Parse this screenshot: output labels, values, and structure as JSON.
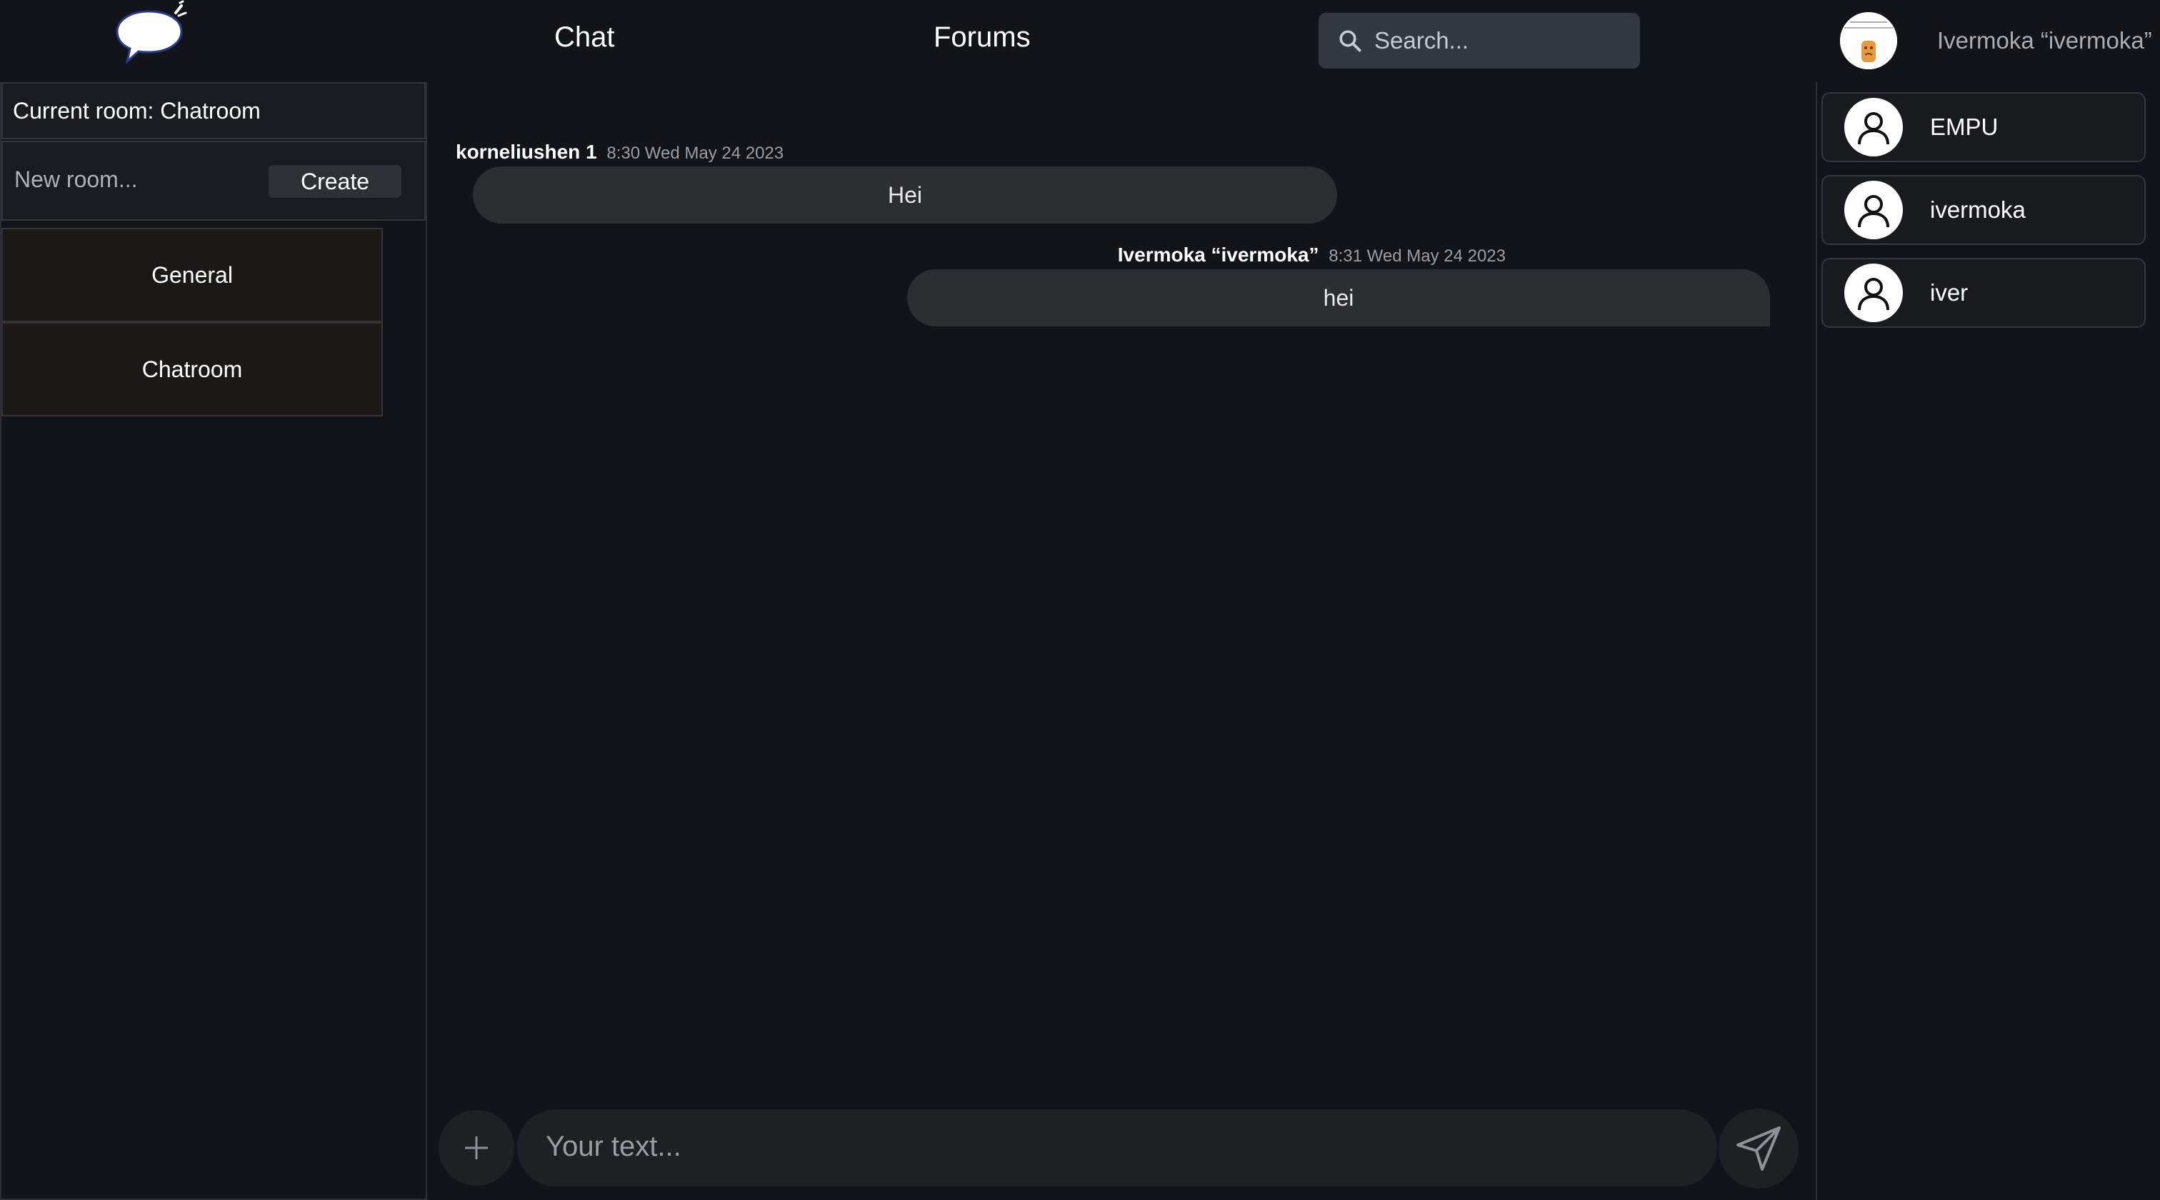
{
  "header": {
    "nav": {
      "chat": "Chat",
      "forums": "Forums"
    },
    "search": {
      "placeholder": "Search...",
      "value": ""
    },
    "profile": {
      "name": "Ivermoka “ivermoka”"
    }
  },
  "left_sidebar": {
    "current_room": "Current room: Chatroom",
    "new_room": {
      "placeholder": "New room...",
      "value": "",
      "create_label": "Create"
    },
    "rooms": [
      {
        "label": "General"
      },
      {
        "label": "Chatroom"
      }
    ]
  },
  "messages": [
    {
      "author": "korneliushen 1",
      "time": "8:30 Wed May 24 2023",
      "text": "Hei",
      "own": false
    },
    {
      "author": "Ivermoka “ivermoka”",
      "time": "8:31 Wed May 24 2023",
      "text": "hei",
      "own": true
    }
  ],
  "composer": {
    "placeholder": "Your text...",
    "value": ""
  },
  "users": [
    {
      "name": "EMPU"
    },
    {
      "name": "ivermoka"
    },
    {
      "name": "iver"
    }
  ],
  "colors": {
    "background": "#111418",
    "bubble": "#2c2e31",
    "input_bg": "#1f2023",
    "room_item_bg": "#1b1918"
  },
  "icons": [
    "chat-bubble-logo",
    "search-icon",
    "plus-icon",
    "send-icon",
    "user-icon"
  ]
}
